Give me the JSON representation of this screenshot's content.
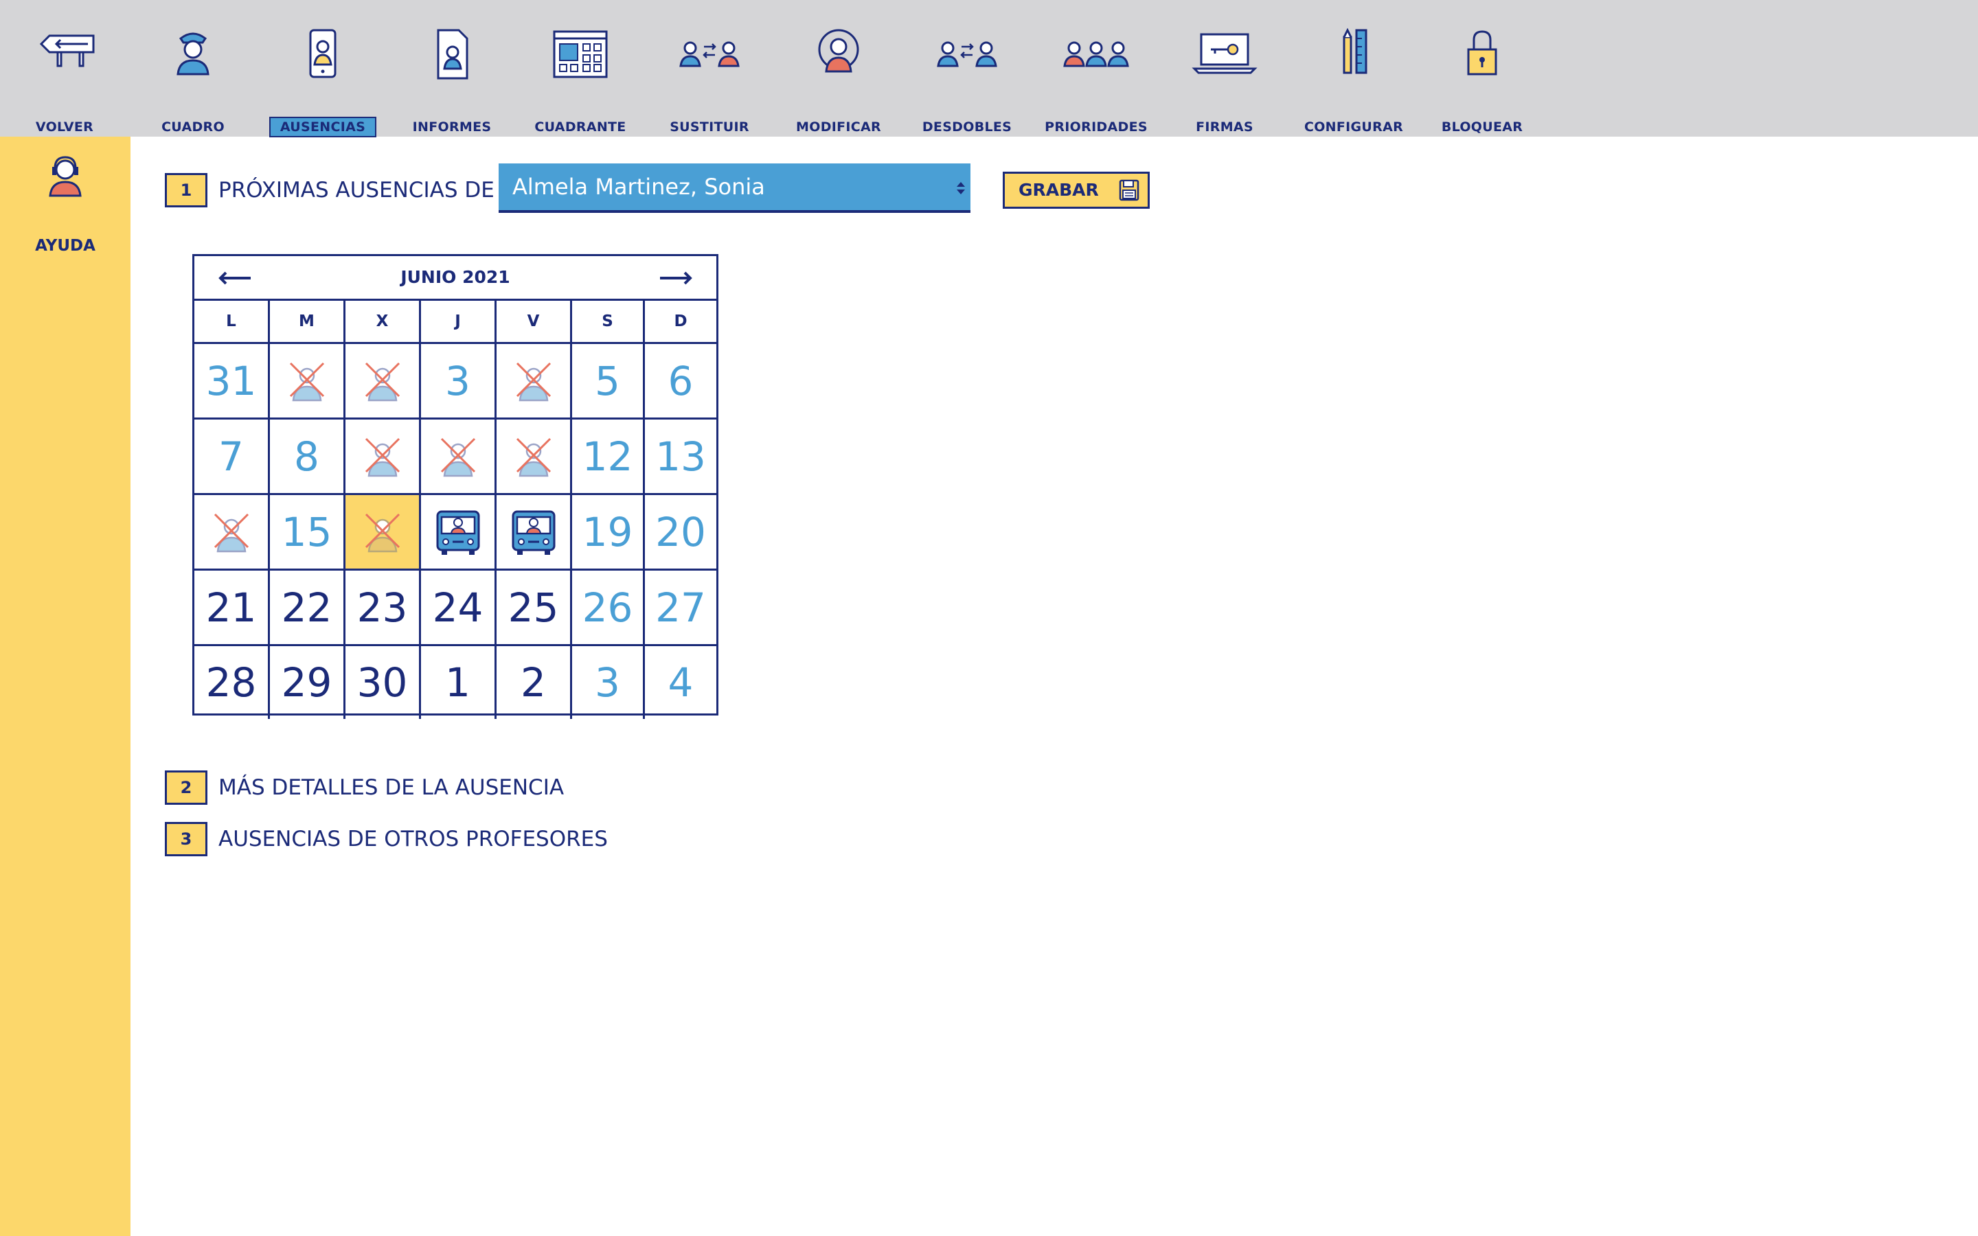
{
  "toolbar": {
    "items": [
      {
        "label": "VOLVER",
        "icon": "back-sign-icon"
      },
      {
        "label": "CUADRO",
        "icon": "officer-icon"
      },
      {
        "label": "AUSENCIAS",
        "icon": "phone-person-icon"
      },
      {
        "label": "INFORMES",
        "icon": "report-icon"
      },
      {
        "label": "CUADRANTE",
        "icon": "calendar-grid-icon"
      },
      {
        "label": "SUSTITUIR",
        "icon": "swap-people-icon"
      },
      {
        "label": "MODIFICAR",
        "icon": "modify-person-icon"
      },
      {
        "label": "DESDOBLES",
        "icon": "split-people-icon"
      },
      {
        "label": "PRIORIDADES",
        "icon": "group-icon"
      },
      {
        "label": "FIRMAS",
        "icon": "laptop-key-icon"
      },
      {
        "label": "CONFIGURAR",
        "icon": "pencil-ruler-icon"
      },
      {
        "label": "BLOQUEAR",
        "icon": "lock-icon"
      }
    ],
    "active": "AUSENCIAS"
  },
  "sidebar": {
    "help_label": "AYUDA"
  },
  "section1": {
    "number": "1",
    "title": "PRÓXIMAS AUSENCIAS DE",
    "selected": "Almela Martinez, Sonia"
  },
  "save": {
    "label": "GRABAR"
  },
  "calendar": {
    "title": "JUNIO 2021",
    "weekdays": [
      "L",
      "M",
      "X",
      "J",
      "V",
      "S",
      "D"
    ],
    "days": [
      [
        "31",
        "",
        "",
        "3",
        "",
        "5",
        "6"
      ],
      [
        "7",
        "8",
        "",
        "",
        "",
        "12",
        "13"
      ],
      [
        "",
        "15",
        "",
        "",
        "",
        "19",
        "20"
      ],
      [
        "21",
        "22",
        "23",
        "24",
        "25",
        "26",
        "27"
      ],
      [
        "28",
        "29",
        "30",
        "1",
        "2",
        "3",
        "4"
      ]
    ]
  },
  "section2": {
    "number": "2",
    "title": "MÁS DETALLES DE LA AUSENCIA"
  },
  "section3": {
    "number": "3",
    "title": "AUSENCIAS DE OTROS PROFESORES"
  },
  "colors": {
    "navy": "#1b2a78",
    "blue": "#4a9fd5",
    "yellow": "#fcd76b",
    "toolbar_bg": "#d5d5d7",
    "cross": "#e8735f"
  }
}
